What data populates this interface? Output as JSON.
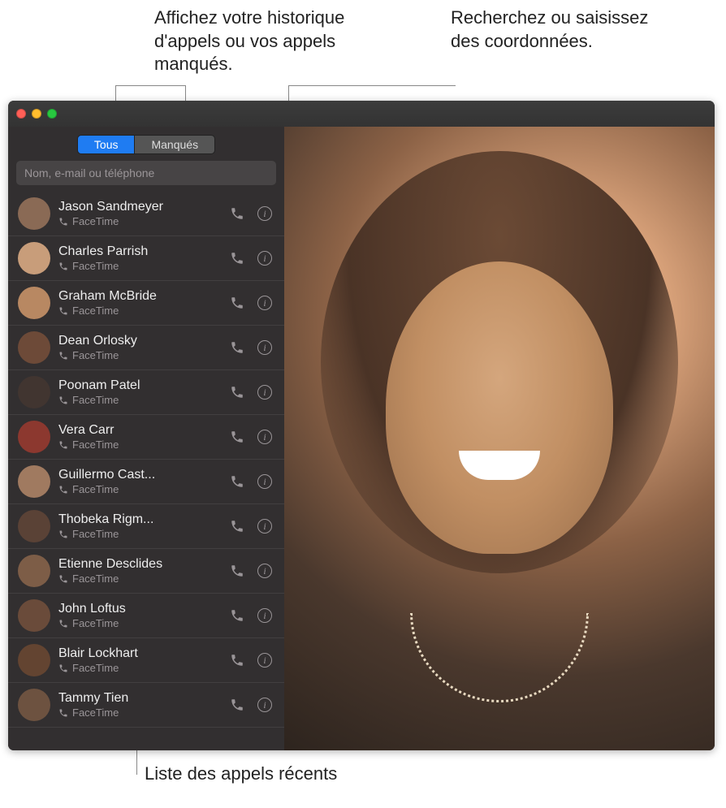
{
  "callouts": {
    "top_left": "Affichez votre historique d'appels ou vos appels manqués.",
    "top_right": "Recherchez ou saisissez des coordonnées.",
    "bottom": "Liste des appels récents"
  },
  "tabs": {
    "all": "Tous",
    "missed": "Manqués"
  },
  "search": {
    "placeholder": "Nom, e-mail ou téléphone"
  },
  "sub_label": "FaceTime",
  "contacts": [
    {
      "name": "Jason Sandmeyer",
      "color": "#8a6a55"
    },
    {
      "name": "Charles Parrish",
      "color": "#c89d7a"
    },
    {
      "name": "Graham McBride",
      "color": "#b88862"
    },
    {
      "name": "Dean Orlosky",
      "color": "#6d4a38"
    },
    {
      "name": "Poonam Patel",
      "color": "#413530"
    },
    {
      "name": "Vera Carr",
      "color": "#8c382f"
    },
    {
      "name": "Guillermo Cast...",
      "color": "#a07a60"
    },
    {
      "name": "Thobeka Rigm...",
      "color": "#5a4236"
    },
    {
      "name": "Etienne Desclides",
      "color": "#7d5d47"
    },
    {
      "name": "John Loftus",
      "color": "#6a4b3a"
    },
    {
      "name": "Blair Lockhart",
      "color": "#634431"
    },
    {
      "name": "Tammy Tien",
      "color": "#6d5240"
    }
  ]
}
